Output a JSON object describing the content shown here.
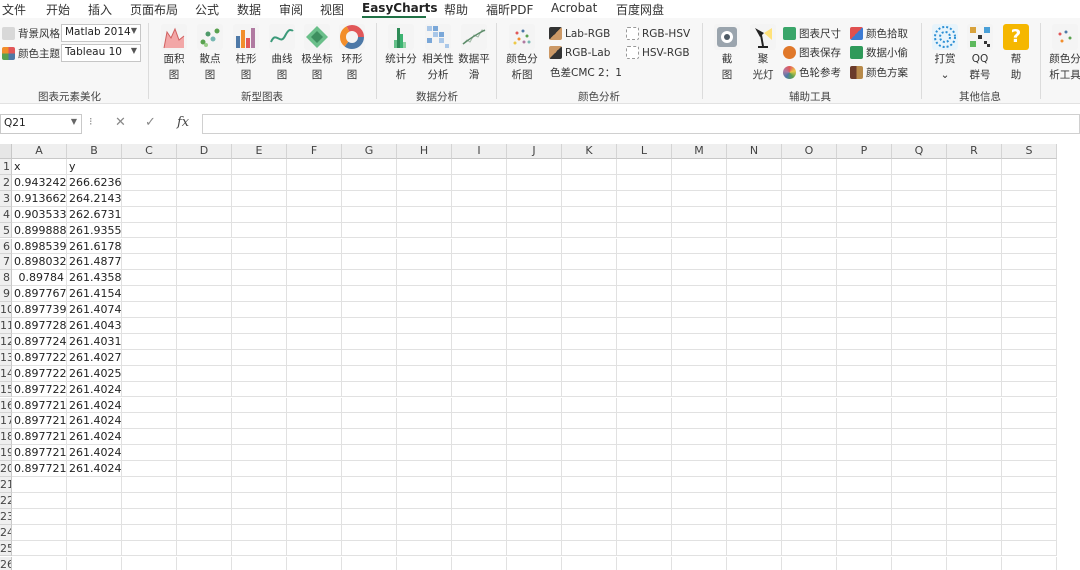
{
  "menu": [
    "文件",
    "开始",
    "插入",
    "页面布局",
    "公式",
    "数据",
    "审阅",
    "视图",
    "EasyCharts",
    "帮助",
    "福昕PDF",
    "Acrobat",
    "百度网盘"
  ],
  "ribbon": {
    "style_group": {
      "bg_style_label": "背景风格",
      "bg_style_value": "Matlab 2014",
      "color_theme_label": "颜色主题",
      "color_theme_value": "Tableau 10",
      "title": "图表元素美化"
    },
    "new_charts": {
      "title": "新型图表",
      "buttons": [
        {
          "l1": "面积",
          "l2": "图"
        },
        {
          "l1": "散点",
          "l2": "图"
        },
        {
          "l1": "柱形",
          "l2": "图"
        },
        {
          "l1": "曲线",
          "l2": "图"
        },
        {
          "l1": "极坐标",
          "l2": "图"
        },
        {
          "l1": "环形",
          "l2": "图"
        }
      ]
    },
    "data_analysis": {
      "title": "数据分析",
      "buttons": [
        {
          "l1": "统计分",
          "l2": "析"
        },
        {
          "l1": "相关性",
          "l2": "分析"
        },
        {
          "l1": "数据平",
          "l2": "滑"
        }
      ]
    },
    "color_analysis": {
      "title": "颜色分析",
      "big": {
        "l1": "颜色分",
        "l2": "析图"
      },
      "lab_rgb": "Lab-RGB",
      "rgb_lab": "RGB-Lab",
      "cmc": "色差CMC 2：1",
      "rgb_hsv": "RGB-HSV",
      "hsv_rgb": "HSV-RGB"
    },
    "tools": {
      "title": "辅助工具",
      "screenshot_l1": "截",
      "screenshot_l2": "图",
      "spotlight_l1": "聚",
      "spotlight_l2": "光灯",
      "chart_size": "图表尺寸",
      "chart_save": "图表保存",
      "color_wheel": "色轮参考",
      "color_pick": "颜色拾取",
      "data_thief": "数据小偷",
      "color_scheme": "颜色方案"
    },
    "other": {
      "title": "其他信息",
      "reward": "打赏",
      "qq_l1": "QQ",
      "qq_l2": "群号",
      "help_l1": "帮",
      "help_l2": "助",
      "extra_l1": "颜色分",
      "extra_l2": "析工具"
    }
  },
  "formula_bar": {
    "name_box": "Q21",
    "cancel": "✕",
    "confirm": "✓",
    "fx": "fx",
    "formula": ""
  },
  "sheet": {
    "columns": [
      "A",
      "B",
      "C",
      "D",
      "E",
      "F",
      "G",
      "H",
      "I",
      "J",
      "K",
      "L",
      "M",
      "N",
      "O",
      "P",
      "Q",
      "R",
      "S"
    ],
    "row_numbers": [
      "1",
      "2",
      "3",
      "4",
      "5",
      "6",
      "7",
      "8",
      "9",
      "10",
      "11",
      "12",
      "13",
      "14",
      "15",
      "16",
      "17",
      "18",
      "19",
      "20",
      "21",
      "22",
      "23",
      "24",
      "25",
      "26"
    ],
    "header": [
      "x",
      "y"
    ],
    "rows": [
      [
        "0.943242",
        "266.6236"
      ],
      [
        "0.913662",
        "264.2143"
      ],
      [
        "0.903533",
        "262.6731"
      ],
      [
        "0.899888",
        "261.9355"
      ],
      [
        "0.898539",
        "261.6178"
      ],
      [
        "0.898032",
        "261.4877"
      ],
      [
        "0.89784",
        "261.4358"
      ],
      [
        "0.897767",
        "261.4154"
      ],
      [
        "0.897739",
        "261.4074"
      ],
      [
        "0.897728",
        "261.4043"
      ],
      [
        "0.897724",
        "261.4031"
      ],
      [
        "0.897722",
        "261.4027"
      ],
      [
        "0.897722",
        "261.4025"
      ],
      [
        "0.897722",
        "261.4024"
      ],
      [
        "0.897721",
        "261.4024"
      ],
      [
        "0.897721",
        "261.4024"
      ],
      [
        "0.897721",
        "261.4024"
      ],
      [
        "0.897721",
        "261.4024"
      ],
      [
        "0.897721",
        "261.4024"
      ]
    ]
  }
}
